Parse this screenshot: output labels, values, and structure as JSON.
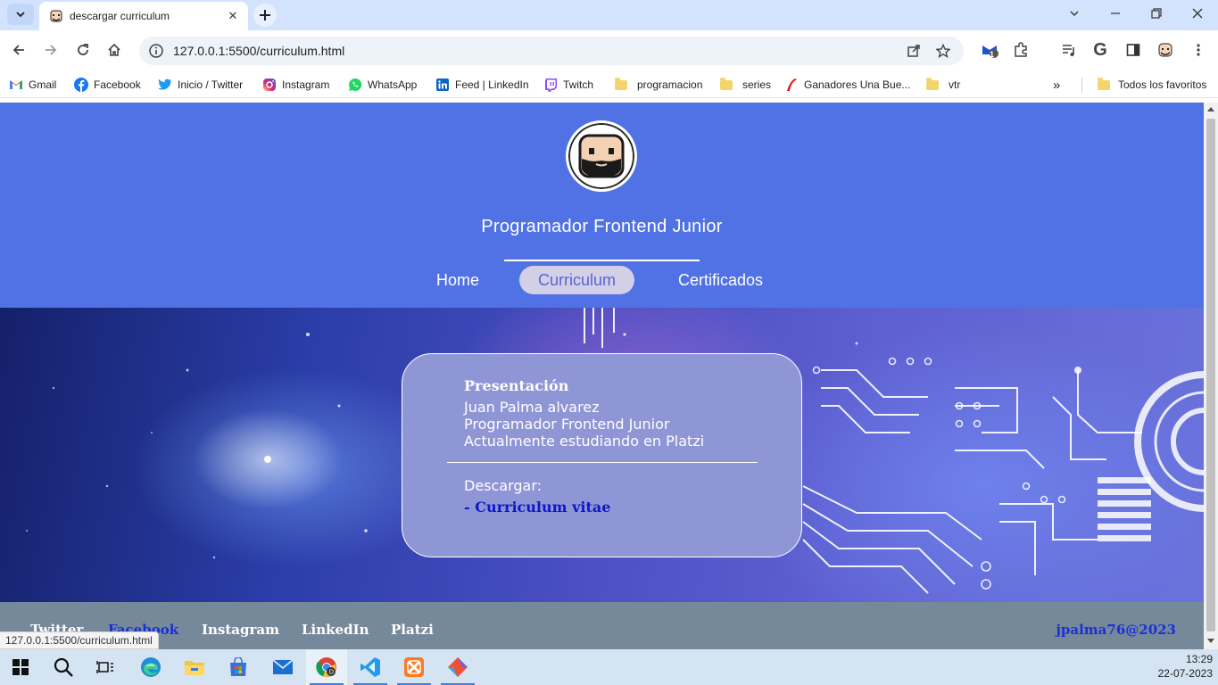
{
  "browser": {
    "tab_title": "descargar curriculum",
    "url": "127.0.0.1:5500/curriculum.html",
    "extension_badge": "1",
    "bookmarks": [
      {
        "label": "Gmail",
        "icon": "gmail-icon"
      },
      {
        "label": "Facebook",
        "icon": "facebook-icon"
      },
      {
        "label": "Inicio / Twitter",
        "icon": "twitter-icon"
      },
      {
        "label": "Instagram",
        "icon": "instagram-icon"
      },
      {
        "label": "WhatsApp",
        "icon": "whatsapp-icon"
      },
      {
        "label": "Feed | LinkedIn",
        "icon": "linkedin-icon"
      },
      {
        "label": "Twitch",
        "icon": "twitch-icon"
      },
      {
        "label": "programacion",
        "icon": "folder-icon"
      },
      {
        "label": "series",
        "icon": "folder-icon"
      },
      {
        "label": "Ganadores Una Bue...",
        "icon": "ganadores-icon"
      },
      {
        "label": "vtr",
        "icon": "folder-icon"
      }
    ],
    "more_bookmarks": "»",
    "all_bookmarks": "Todos los favoritos",
    "status_url": "127.0.0.1:5500/curriculum.html"
  },
  "page": {
    "job_title": "Programador Frontend Junior",
    "nav": {
      "home": "Home",
      "curriculum": "Curriculum",
      "certificados": "Certificados",
      "active": "Curriculum"
    },
    "presentation": {
      "heading": "Presentación",
      "lines": [
        "Juan Palma alvarez",
        "Programador Frontend Junior",
        "Actualmente estudiando en Platzi"
      ],
      "download_label": "Descargar:",
      "download_link": "- Curriculum vitae"
    },
    "footer": {
      "links": [
        "Twitter",
        "Facebook",
        "Instagram",
        "LinkedIn",
        "Platzi"
      ],
      "copyright": "jpalma76@2023"
    },
    "colors": {
      "header": "#5072e4",
      "card": "#8f96d6",
      "footer": "#76899b",
      "link": "#0f16c8"
    }
  },
  "taskbar": {
    "apps": [
      "windows-start-icon",
      "search-icon",
      "task-view-icon",
      "edge-icon",
      "file-explorer-icon",
      "microsoft-store-icon",
      "mail-icon",
      "chrome-icon",
      "vscode-icon",
      "xampp-icon",
      "git-icon"
    ],
    "time": "13:29",
    "date": "22-07-2023"
  }
}
